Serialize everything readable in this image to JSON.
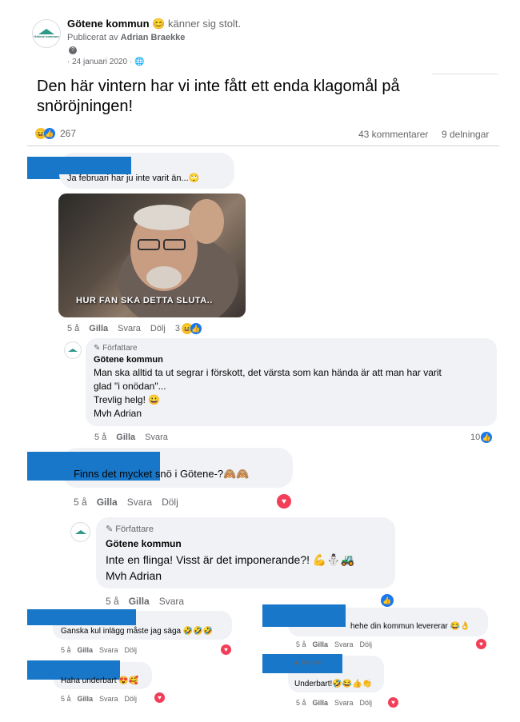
{
  "post": {
    "page_name": "Götene kommun",
    "feeling_emoji": "😊",
    "feeling": "känner sig stolt.",
    "published_by_prefix": "Publicerat av",
    "published_by": "Adrian Braekke",
    "date": "· 24 januari 2020 ·",
    "text": "Den här vintern har vi inte fått ett enda klagomål på snöröjningen!",
    "reactions_count": "267",
    "comments": "43 kommentarer",
    "shares": "9 delningar"
  },
  "logo_text": "Götene kommun",
  "comments": [
    {
      "text": "Ja februari har ju inte varit än...🙄",
      "meme_caption": "HUR FAN SKA DETTA SLUTA..",
      "time": "5 å",
      "like": "Gilla",
      "reply": "Svara",
      "hide": "Dölj",
      "reactions": "3"
    },
    {
      "author_badge": "Författare",
      "name": "Götene kommun",
      "lines": [
        "Man ska alltid ta ut segrar i förskott, det värsta som kan hända är att man har varit",
        "glad \"i onödan\"...",
        "Trevlig helg! 😀",
        "Mvh Adrian"
      ],
      "time": "5 å",
      "like": "Gilla",
      "reply": "Svara",
      "reactions": "10"
    },
    {
      "text": "Finns det mycket snö i Götene-?🙈🙈",
      "time": "5 å",
      "like": "Gilla",
      "reply": "Svara",
      "hide": "Dölj"
    },
    {
      "author_badge": "Författare",
      "name": "Götene kommun",
      "lines": [
        "Inte en flinga! Visst är det imponerande?! 💪⛄🚜",
        "Mvh Adrian"
      ],
      "time": "5 å",
      "like": "Gilla",
      "reply": "Svara"
    },
    {
      "text": "Ganska kul inlägg måste jag säga 🤣🤣🤣",
      "time": "5 å",
      "like": "Gilla",
      "reply": "Svara",
      "hide": "Dölj"
    },
    {
      "text": "hehe din kommun levererar 😂👌",
      "time": "5 å",
      "like": "Gilla",
      "reply": "Svara",
      "hide": "Dölj"
    },
    {
      "text": "Haha underbart 😍🥰",
      "time": "5 å",
      "like": "Gilla",
      "reply": "Svara",
      "hide": "Dölj"
    },
    {
      "badge": "Stort fan",
      "text": "Underbart!🤣😂👍👏",
      "time": "5 å",
      "like": "Gilla",
      "reply": "Svara",
      "hide": "Dölj"
    }
  ],
  "icons": [
    "globe-icon",
    "pencil-icon",
    "like-icon",
    "haha-icon",
    "heart-icon",
    "diamond-icon"
  ],
  "colors": {
    "like": "#1877f2",
    "heart": "#f33e58",
    "redaction": "#1877c9",
    "bubble": "#f0f2f5"
  }
}
